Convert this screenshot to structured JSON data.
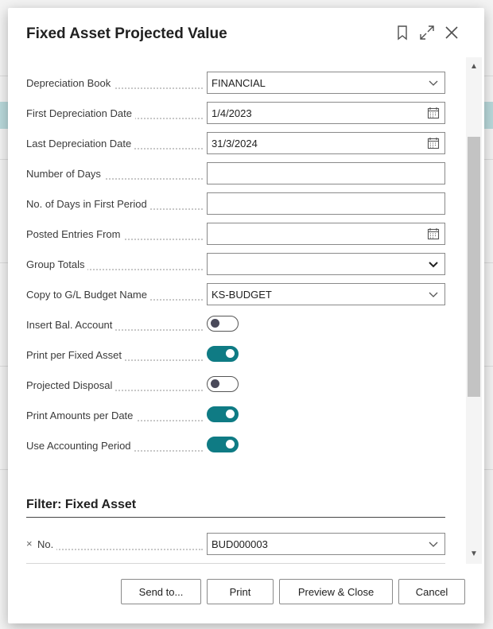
{
  "dialog": {
    "title": "Fixed Asset Projected Value",
    "header_icons": [
      "bookmark-icon",
      "expand-icon",
      "close-icon"
    ]
  },
  "fields": [
    {
      "label": "Depreciation Book",
      "value": "FINANCIAL",
      "type": "dropdown"
    },
    {
      "label": "First Depreciation Date",
      "value": "1/4/2023",
      "type": "date"
    },
    {
      "label": "Last Depreciation Date",
      "value": "31/3/2024",
      "type": "date"
    },
    {
      "label": "Number of Days",
      "value": "",
      "type": "text"
    },
    {
      "label": "No. of Days in First Period",
      "value": "",
      "type": "text"
    },
    {
      "label": "Posted Entries From",
      "value": "",
      "type": "date"
    },
    {
      "label": "Group Totals",
      "value": "",
      "type": "select"
    },
    {
      "label": "Copy to G/L Budget Name",
      "value": "KS-BUDGET",
      "type": "dropdown"
    }
  ],
  "toggles": [
    {
      "label": "Insert Bal. Account",
      "on": false
    },
    {
      "label": "Print per Fixed Asset",
      "on": true
    },
    {
      "label": "Projected Disposal",
      "on": false
    },
    {
      "label": "Print Amounts per Date",
      "on": true
    },
    {
      "label": "Use Accounting Period",
      "on": true
    }
  ],
  "filter": {
    "title": "Filter: Fixed Asset",
    "remove_symbol": "×",
    "field_label": "No.",
    "field_value": "BUD000003"
  },
  "buttons": {
    "send_to": "Send to...",
    "print": "Print",
    "preview_close": "Preview & Close",
    "cancel": "Cancel"
  },
  "colors": {
    "toggle_on": "#0f7b84",
    "background_highlight": "#b9d9db"
  }
}
